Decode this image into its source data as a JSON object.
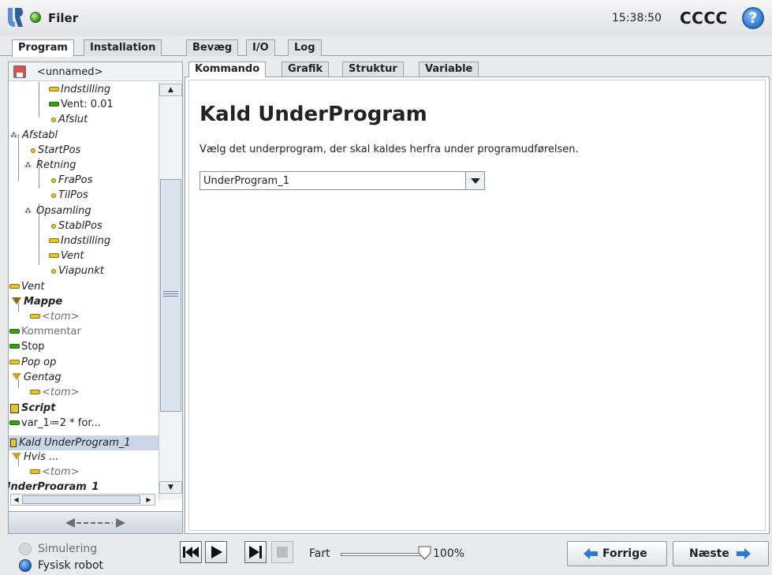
{
  "header": {
    "app_title": "Filer",
    "clock": "15:38:50",
    "robot_name": "CCCC",
    "help_label": "?"
  },
  "main_tabs": [
    "Program",
    "Installation",
    "Bevæg",
    "I/O",
    "Log"
  ],
  "sub_tabs": [
    "Kommando",
    "Grafik",
    "Struktur",
    "Variable"
  ],
  "file": {
    "name": "<unnamed>"
  },
  "tree": [
    {
      "label": "Indstilling",
      "icon": "yellow-bar-icon"
    },
    {
      "label": "Vent: 0.01",
      "icon": "green-bar-icon"
    },
    {
      "label": "Afslut",
      "icon": "waypoint-icon"
    },
    {
      "label": "Afstabl",
      "icon": "pattern-icon"
    },
    {
      "label": "StartPos",
      "icon": "waypoint-icon"
    },
    {
      "label": "Retning",
      "icon": "pattern-icon"
    },
    {
      "label": "FraPos",
      "icon": "waypoint-icon"
    },
    {
      "label": "TilPos",
      "icon": "waypoint-icon"
    },
    {
      "label": "Opsamling",
      "icon": "pattern-icon"
    },
    {
      "label": "StablPos",
      "icon": "waypoint-icon"
    },
    {
      "label": "Indstilling",
      "icon": "yellow-bar-icon"
    },
    {
      "label": "Vent",
      "icon": "yellow-bar-icon"
    },
    {
      "label": "Viapunkt",
      "icon": "waypoint-icon"
    },
    {
      "label": "Vent",
      "icon": "yellow-bar-icon"
    },
    {
      "label": "Mappe",
      "icon": "folder-triangle-icon"
    },
    {
      "label": "<tom>",
      "icon": "yellow-bar-icon"
    },
    {
      "label": "Kommentar",
      "icon": "green-bar-icon"
    },
    {
      "label": "Stop",
      "icon": "green-bar-icon"
    },
    {
      "label": "Pop op",
      "icon": "yellow-bar-icon"
    },
    {
      "label": "Gentag",
      "icon": "loop-triangle-icon"
    },
    {
      "label": "<tom>",
      "icon": "yellow-bar-icon"
    },
    {
      "label": "Script",
      "icon": "script-icon"
    },
    {
      "label": "var_1≔2 * for...",
      "icon": "green-bar-icon"
    },
    {
      "label": "Kald UnderProgram_1",
      "icon": "call-icon"
    },
    {
      "label": "Hvis ...",
      "icon": "if-triangle-icon"
    },
    {
      "label": "<tom>",
      "icon": "yellow-bar-icon"
    },
    {
      "label": "UnderProgram_1",
      "icon": "none"
    }
  ],
  "content": {
    "title": "Kald UnderProgram",
    "description": "Vælg det underprogram, der skal kaldes herfra under programudførelsen.",
    "subprogram_select": {
      "value": "UnderProgram_1"
    }
  },
  "footer": {
    "mode_simulation": "Simulering",
    "mode_real": "Fysisk robot",
    "speed_label": "Fart",
    "speed_value": "100%",
    "speed_fraction": 1.0,
    "prev_label": "Forrige",
    "next_label": "Næste"
  },
  "colors": {
    "status_ok": "#3c9b16",
    "selection": "#c8d6e6",
    "accent": "#2f78cf"
  }
}
